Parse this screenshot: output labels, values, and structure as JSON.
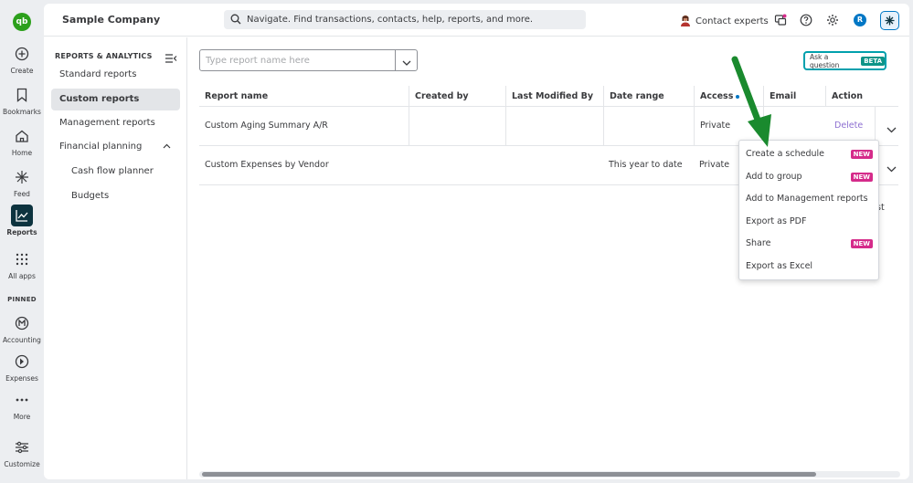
{
  "rail": {
    "logo": "qb",
    "items": [
      {
        "label": "Create",
        "icon": "plus-circle-icon"
      },
      {
        "label": "Bookmarks",
        "icon": "bookmark-icon"
      },
      {
        "label": "Home",
        "icon": "home-icon"
      },
      {
        "label": "Feed",
        "icon": "sparkle-icon"
      },
      {
        "label": "Reports",
        "icon": "chart-line-icon"
      },
      {
        "label": "All apps",
        "icon": "grid-icon"
      }
    ],
    "pinned_label": "PINNED",
    "pinned": [
      {
        "label": "Accounting",
        "icon": "accounting-icon"
      },
      {
        "label": "Expenses",
        "icon": "expenses-icon"
      },
      {
        "label": "More",
        "icon": "more-dots-icon"
      }
    ],
    "customize": "Customize"
  },
  "topbar": {
    "company": "Sample Company",
    "search_placeholder": "Navigate. Find transactions, contacts, help, reports, and more.",
    "contact": "Contact experts",
    "avatar_initial": "R"
  },
  "subnav": {
    "header": "REPORTS & ANALYTICS",
    "items": [
      {
        "label": "Standard reports"
      },
      {
        "label": "Custom reports"
      },
      {
        "label": "Management reports"
      },
      {
        "label": "Financial planning"
      },
      {
        "label": "Cash flow planner"
      },
      {
        "label": "Budgets"
      }
    ]
  },
  "filter": {
    "placeholder": "Type report name here"
  },
  "ask": {
    "label": "Ask a question",
    "badge": "BETA"
  },
  "table": {
    "headers": [
      "Report name",
      "Created by",
      "Last Modified By",
      "Date range",
      "Access",
      "Email",
      "Action"
    ],
    "rows": [
      {
        "name": "Custom Aging Summary A/R",
        "created_by": "",
        "modified_by": "",
        "date_range": "",
        "access": "Private",
        "email": "",
        "action": "Delete"
      },
      {
        "name": "Custom Expenses by Vendor",
        "created_by": "",
        "modified_by": "",
        "date_range": "This year to date",
        "access": "Private",
        "email": "",
        "action": ""
      }
    ],
    "trailing_text": "st"
  },
  "menu": {
    "items": [
      {
        "label": "Create a schedule",
        "badge": "NEW"
      },
      {
        "label": "Add to group",
        "badge": "NEW"
      },
      {
        "label": "Add to Management reports",
        "badge": ""
      },
      {
        "label": "Export as PDF",
        "badge": ""
      },
      {
        "label": "Share",
        "badge": "NEW"
      },
      {
        "label": "Export as Excel",
        "badge": ""
      }
    ]
  },
  "colors": {
    "brand_green": "#2ca01c",
    "new_badge": "#d52b8a",
    "delete_link": "#8d6fd1",
    "arrow": "#1a8a2e"
  }
}
